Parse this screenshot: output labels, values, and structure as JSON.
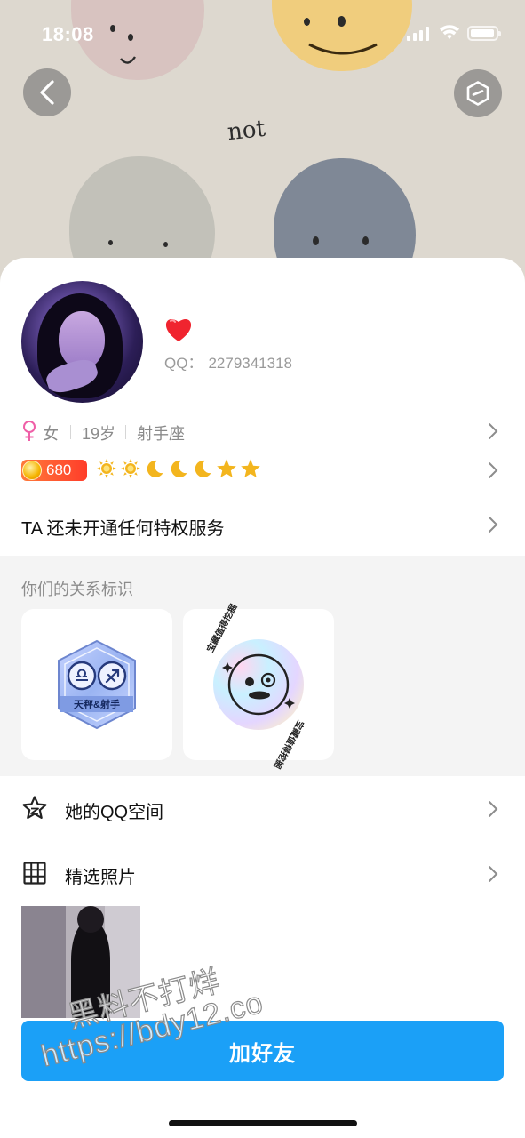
{
  "status_bar": {
    "time": "18:08"
  },
  "cover": {
    "word": "not"
  },
  "profile": {
    "qq_label": "QQ：",
    "qq_number": "2279341318",
    "gender": "女",
    "age": "19岁",
    "zodiac": "射手座",
    "coin_level": "680",
    "level_icons": [
      "sun",
      "sun",
      "moon",
      "moon",
      "moon",
      "star",
      "star"
    ],
    "privilege_text": "TA 还未开通任何特权服务"
  },
  "relationship": {
    "title": "你们的关系标识",
    "badge1_label": "天秤&射手",
    "badge2_text": "宝藏值得挖掘"
  },
  "menu": {
    "qzone_label": "她的QQ空间",
    "photos_label": "精选照片"
  },
  "actions": {
    "add_friend": "加好友"
  },
  "watermark": {
    "line1": "黑料不打烊",
    "line2": "https://bdy12.co"
  },
  "colors": {
    "accent_blue": "#1ba0f7",
    "female_pink": "#ef5fa7",
    "coin_badge": "#ff4a2c"
  }
}
